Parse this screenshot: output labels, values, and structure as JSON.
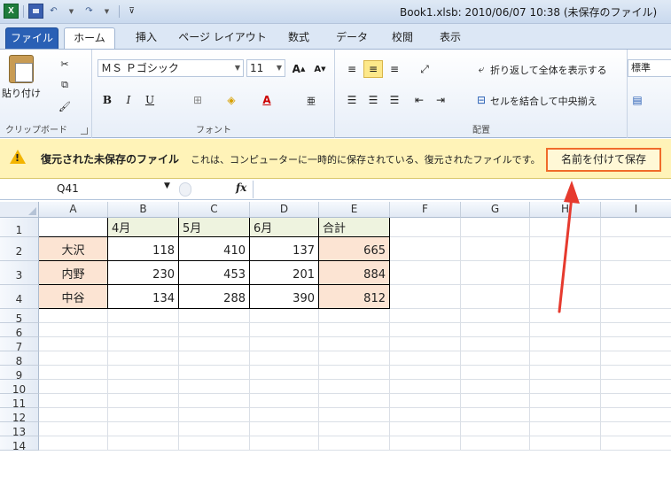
{
  "window": {
    "title": "Book1.xlsb: 2010/06/07 10:38 (未保存のファイル)",
    "app_icon": "X"
  },
  "tabs": [
    {
      "label": "ファイル",
      "kind": "file"
    },
    {
      "label": "ホーム",
      "kind": "active"
    },
    {
      "label": "挿入"
    },
    {
      "label": "ページ レイアウト"
    },
    {
      "label": "数式"
    },
    {
      "label": "データ"
    },
    {
      "label": "校閲"
    },
    {
      "label": "表示"
    }
  ],
  "ribbon": {
    "clipboard": {
      "paste_label": "貼り付け",
      "group_label": "クリップボード"
    },
    "font": {
      "font_name": "ＭＳ Ｐゴシック",
      "font_size": "11",
      "bold": "B",
      "italic": "I",
      "underline": "U",
      "group_label": "フォント"
    },
    "alignment": {
      "wrap_text": "折り返して全体を表示する",
      "merge_center": "セルを結合して中央揃え",
      "group_label": "配置"
    },
    "number": {
      "format": "標準"
    }
  },
  "message_bar": {
    "title": "復元された未保存のファイル",
    "text": "これは、コンピューターに一時的に保存されている、復元されたファイルです。",
    "button": "名前を付けて保存",
    "accent": "#f06b2a"
  },
  "formula_bar": {
    "name_box": "Q41",
    "fx": "fx",
    "value": ""
  },
  "sheet": {
    "columns": [
      "A",
      "B",
      "C",
      "D",
      "E",
      "F",
      "G",
      "H",
      "I"
    ],
    "rows": [
      "1",
      "2",
      "3",
      "4",
      "5",
      "6",
      "7",
      "8",
      "9",
      "10",
      "11",
      "12",
      "13",
      "14"
    ],
    "header": [
      "",
      "4月",
      "5月",
      "6月",
      "合計"
    ],
    "data": [
      [
        "大沢",
        "118",
        "410",
        "137",
        "665"
      ],
      [
        "内野",
        "230",
        "453",
        "201",
        "884"
      ],
      [
        "中谷",
        "134",
        "288",
        "390",
        "812"
      ]
    ]
  }
}
